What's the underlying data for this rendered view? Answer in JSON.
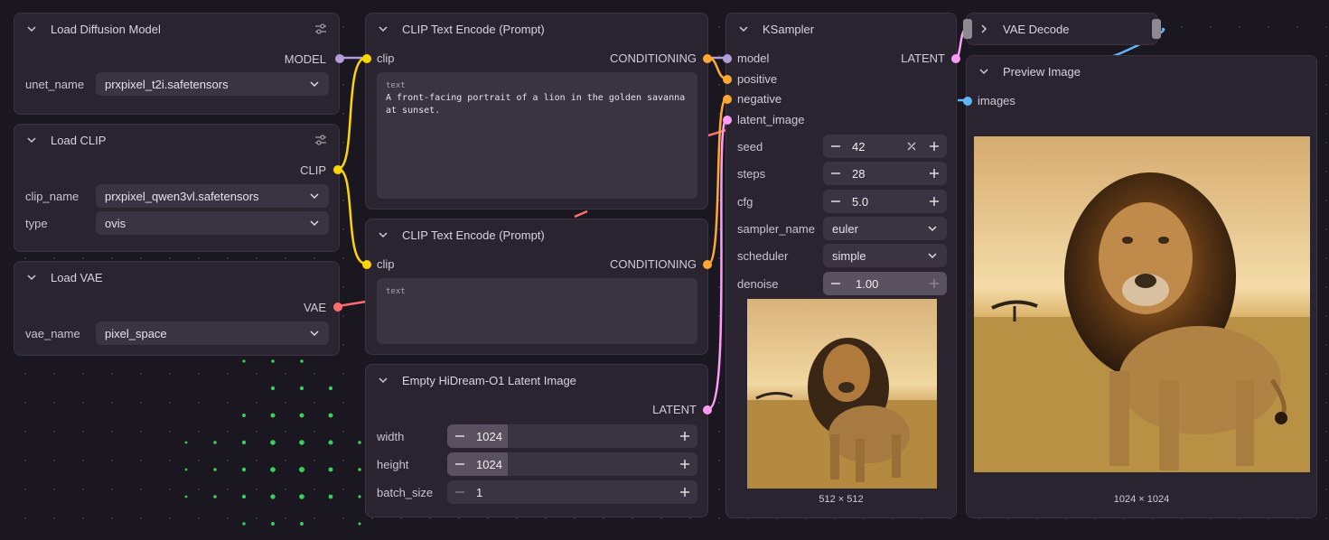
{
  "colors": {
    "model": "#b39ddb",
    "clip": "#ffd500",
    "conditioning": "#ffa931",
    "latent": "#ff9cf9",
    "vae": "#ff6e6e",
    "image": "#64b5f6"
  },
  "load_diffusion": {
    "title": "Load Diffusion Model",
    "output": "MODEL",
    "unet_label": "unet_name",
    "unet_value": "prxpixel_t2i.safetensors"
  },
  "load_clip": {
    "title": "Load CLIP",
    "output": "CLIP",
    "clip_label": "clip_name",
    "clip_value": "prxpixel_qwen3vl.safetensors",
    "type_label": "type",
    "type_value": "ovis"
  },
  "load_vae": {
    "title": "Load VAE",
    "output": "VAE",
    "vae_label": "vae_name",
    "vae_value": "pixel_space"
  },
  "clip_text_pos": {
    "title": "CLIP Text Encode (Prompt)",
    "input": "clip",
    "output": "CONDITIONING",
    "text_label": "text",
    "text": "A front-facing portrait of a lion in the golden savanna at sunset."
  },
  "clip_text_neg": {
    "title": "CLIP Text Encode (Prompt)",
    "input": "clip",
    "output": "CONDITIONING",
    "text_label": "text",
    "text": ""
  },
  "empty_latent": {
    "title": "Empty HiDream-O1 Latent Image",
    "output": "LATENT",
    "width_label": "width",
    "width_value": "1024",
    "height_label": "height",
    "height_value": "1024",
    "batch_label": "batch_size",
    "batch_value": "1"
  },
  "ksampler": {
    "title": "KSampler",
    "in_model": "model",
    "in_positive": "positive",
    "in_negative": "negative",
    "in_latent": "latent_image",
    "output": "LATENT",
    "seed_label": "seed",
    "seed_value": "42",
    "steps_label": "steps",
    "steps_value": "28",
    "cfg_label": "cfg",
    "cfg_value": "5.0",
    "sampler_label": "sampler_name",
    "sampler_value": "euler",
    "scheduler_label": "scheduler",
    "scheduler_value": "simple",
    "denoise_label": "denoise",
    "denoise_value": "1.00",
    "preview_caption": "512 × 512"
  },
  "vae_decode": {
    "title": "VAE Decode"
  },
  "preview": {
    "title": "Preview Image",
    "input": "images",
    "caption": "1024 × 1024"
  }
}
